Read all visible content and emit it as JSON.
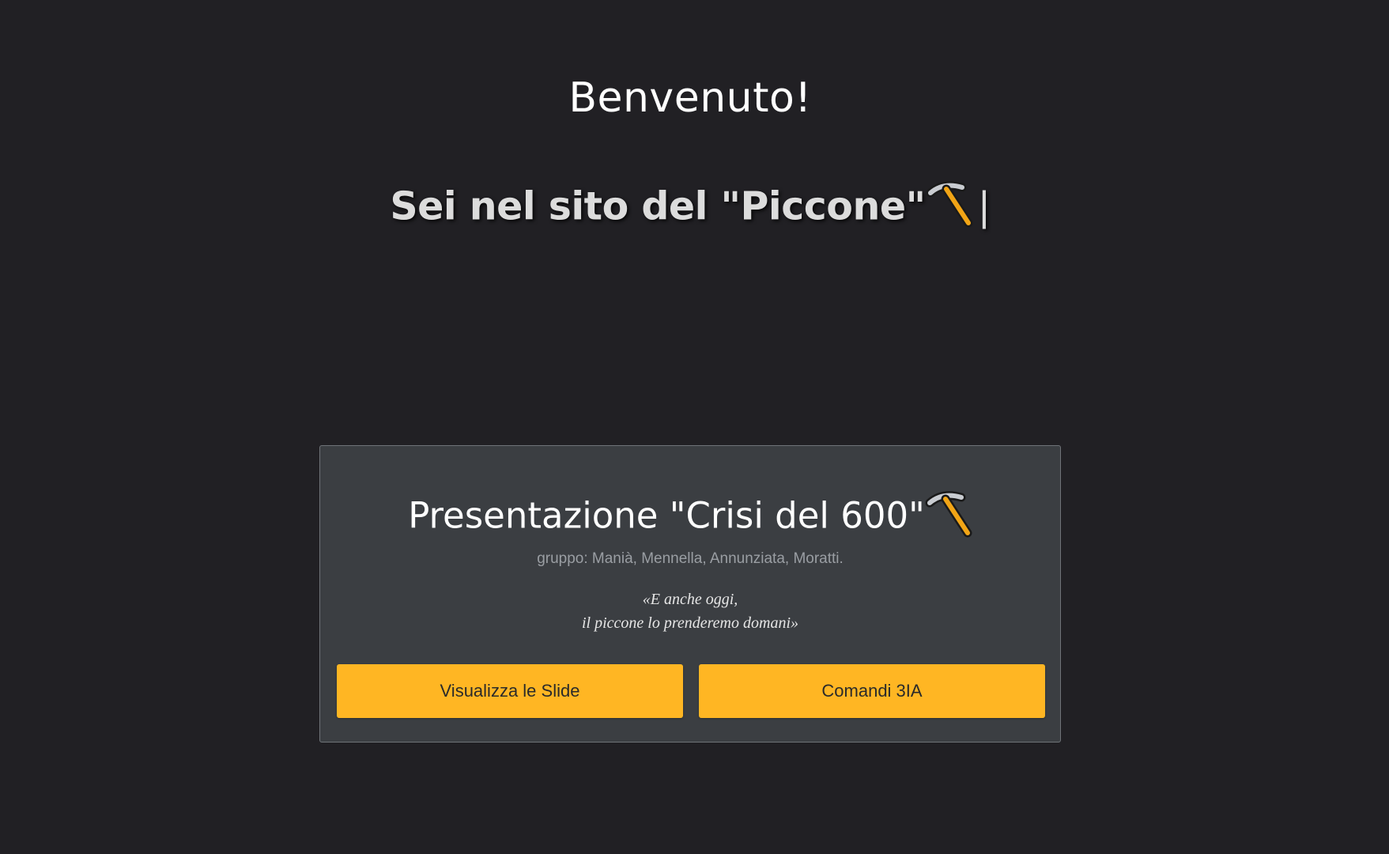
{
  "header": {
    "welcome": "Benvenuto!",
    "typing_text": "Sei nel sito del \"Piccone\"",
    "typing_icon": "pick-icon",
    "cursor": "|"
  },
  "card": {
    "title": "Presentazione \"Crisi del 600\"",
    "title_icon": "pick-icon",
    "subtitle": "gruppo: Manià, Mennella, Annunziata, Moratti.",
    "quote_line1": "«E anche oggi,",
    "quote_line2": "il piccone lo prenderemo domani»",
    "buttons": [
      {
        "label": "Visualizza le Slide"
      },
      {
        "label": "Comandi 3IA"
      }
    ]
  },
  "colors": {
    "background": "#212024",
    "card_background": "#3b3e42",
    "button": "#ffb623"
  }
}
